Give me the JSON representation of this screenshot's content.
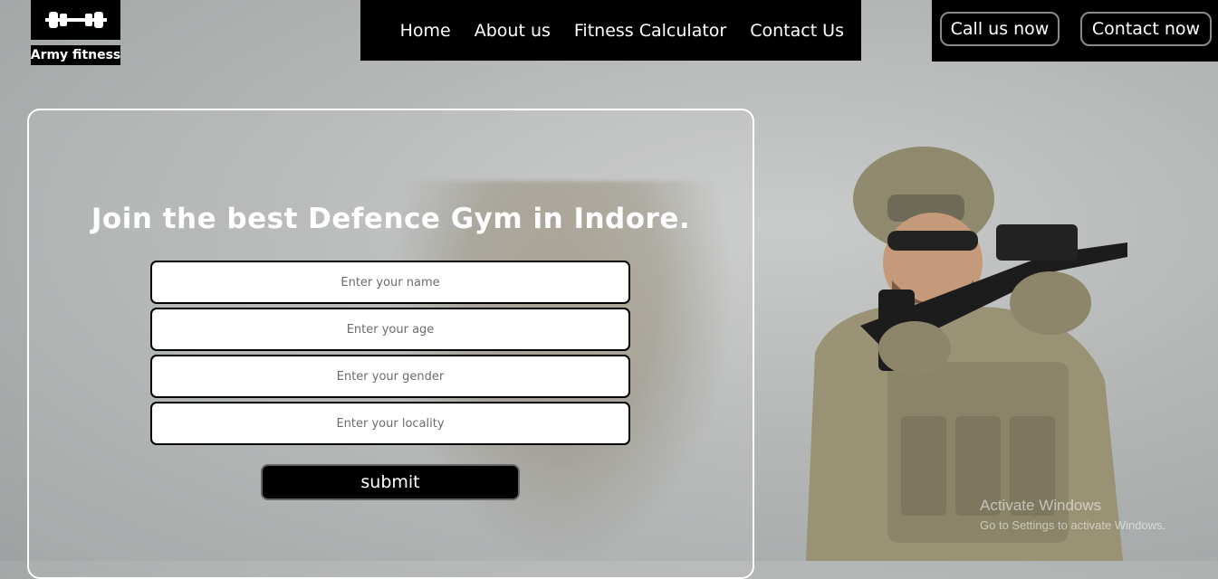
{
  "brand": {
    "name": "Army fitness",
    "logo_icon": "dumbbell-icon"
  },
  "nav": [
    {
      "label": "Home"
    },
    {
      "label": "About us"
    },
    {
      "label": "Fitness Calculator"
    },
    {
      "label": "Contact Us"
    }
  ],
  "cta": {
    "call_label": "Call us now",
    "contact_label": "Contact now"
  },
  "hero": {
    "headline": "Join the best Defence Gym in Indore."
  },
  "form": {
    "name_placeholder": "Enter your name",
    "age_placeholder": "Enter your age",
    "gender_placeholder": "Enter your gender",
    "locality_placeholder": "Enter your locality",
    "submit_label": "submit"
  },
  "watermark": {
    "line1": "Activate Windows",
    "line2": "Go to Settings to activate Windows."
  },
  "colors": {
    "bar": "#000000",
    "text_light": "#ffffff",
    "field_bg": "#ffffff"
  }
}
